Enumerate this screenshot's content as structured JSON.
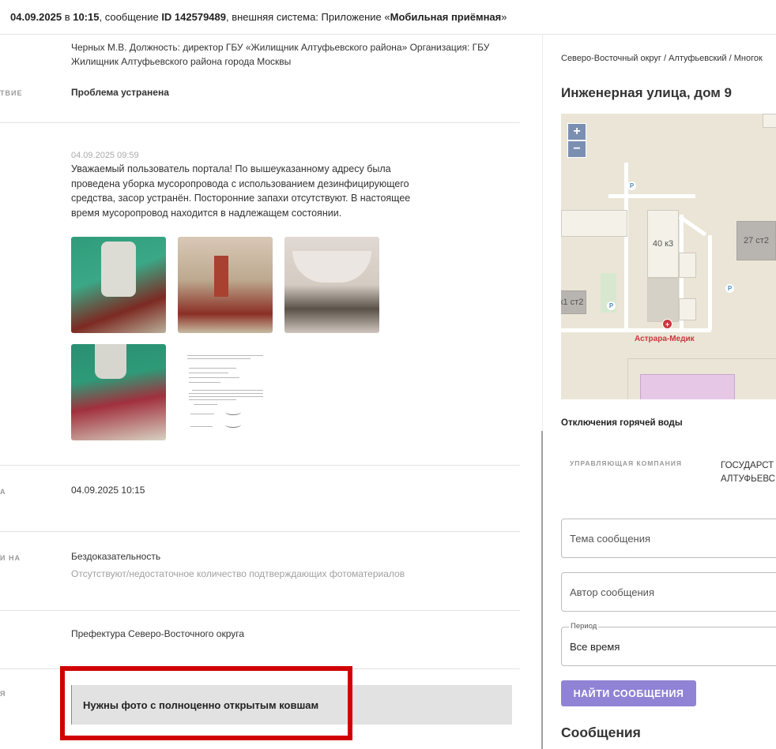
{
  "topbar": {
    "date": "04.09.2025",
    "in_word": " в ",
    "time": "10:15",
    "msg_prefix": ", сообщение ",
    "msg_id": "ID 142579489",
    "system_prefix": ", внешняя система: Приложение «",
    "system_name": "Мобильная приёмная",
    "system_suffix": "»"
  },
  "rows": {
    "responsible": {
      "text": "Черных М.В. Должность: директор ГБУ «Жилищник Алтуфьевского района» Организация: ГБУ Жилищник Алтуфьевского района города Москвы"
    },
    "result": {
      "label": "ТВИЕ",
      "value": "Проблема устранена"
    },
    "reply": {
      "timestamp": "04.09.2025 09:59",
      "text": "Уважаемый пользователь портала! По вышеуказанному адресу была проведена уборка мусоропровода с использованием дезинфицирующего средства, засор устранён. Посторонние запахи отсутствуют. В настоящее время мусоропровод находится в надлежащем состоянии."
    },
    "date_row": {
      "label": "А",
      "value": "04.09.2025 10:15"
    },
    "complaint": {
      "label": "И НА",
      "value": "Бездоказательность",
      "sub": "Отсутствуют/недостаточное количество подтверждающих фотоматериалов"
    },
    "org": {
      "value": "Префектура Северо-Восточного округа"
    },
    "comment": {
      "label": "Я",
      "value": "Нужны фото с полноценно открытым ковшам"
    }
  },
  "right": {
    "breadcrumb": "Северо-Восточный округ / Алтуфьевский / Многок",
    "address": "Инженерная улица, дом 9",
    "map": {
      "zoom_in": "+",
      "zoom_out": "−",
      "b1": "40 к3",
      "b2": "27 ст2",
      "b3": "к1 ст2",
      "poi": "Астрара-Медик",
      "parking": "P",
      "poi_glyph": "+"
    },
    "hotwater_title": "Отключения горячей воды",
    "mc_label": "УПРАВЛЯЮЩАЯ КОМПАНИЯ",
    "mc_value_1": "ГОСУДАРСТ",
    "mc_value_2": "АЛТУФЬЕВС",
    "topic_placeholder": "Тема сообщения",
    "author_placeholder": "Автор сообщения",
    "period_legend": "Период",
    "period_value": "Все время",
    "find_button": "НАЙТИ СООБЩЕНИЯ",
    "messages_title": "Сообщения"
  },
  "colors": {
    "accent": "#9083d5",
    "highlight_frame": "#d10000",
    "map_zoom": "#7b8fb1",
    "poi": "#c9373c"
  }
}
